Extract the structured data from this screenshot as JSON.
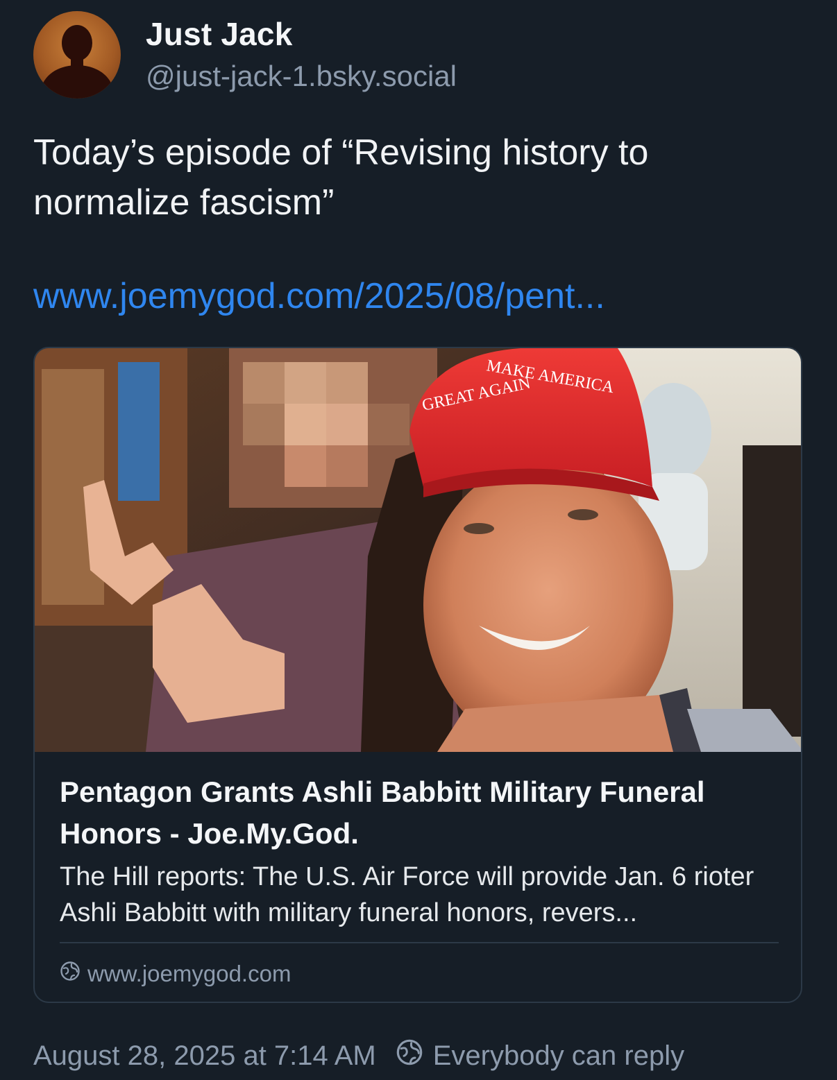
{
  "author": {
    "display_name": "Just Jack",
    "handle": "@just-jack-1.bsky.social"
  },
  "post": {
    "text": "Today’s episode of “Revising history to normalize fascism”",
    "link_text": "www.joemygod.com/2025/08/pent..."
  },
  "card": {
    "hat_line1": "MAKE AMERICA",
    "hat_line2": "GREAT AGAIN",
    "title": "Pentagon Grants Ashli Babbitt Military Funeral Honors - Joe.My.God.",
    "description": "The Hill reports: The U.S. Air Force will provide Jan. 6 rioter Ashli Babbitt with military funeral honors, revers...",
    "domain": "www.joemygod.com",
    "domain_icon": "globe-icon"
  },
  "footer": {
    "timestamp": "August 28, 2025 at 7:14 AM",
    "reply_setting": "Everybody can reply",
    "reply_icon": "globe-icon"
  },
  "colors": {
    "background": "#161e27",
    "link": "#2f86ef",
    "muted": "#8d9bad",
    "border": "#2c3947"
  }
}
